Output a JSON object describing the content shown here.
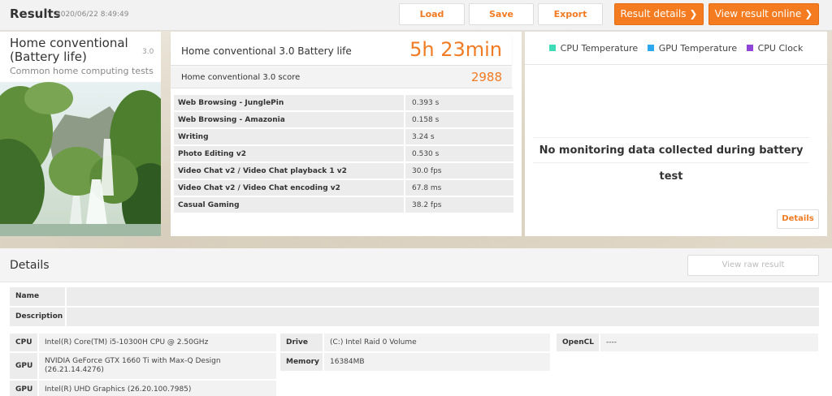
{
  "header": {
    "title": "Results",
    "date": "2020/06/22 8:49:49",
    "buttons": {
      "load": "Load",
      "save": "Save",
      "export": "Export",
      "result_details": "Result details",
      "view_online": "View result online"
    }
  },
  "test": {
    "name": "Home conventional (Battery life)",
    "version": "3.0",
    "description": "Common home computing tests"
  },
  "scores": {
    "main_label": "Home conventional 3.0 Battery life",
    "main_value": "5h 23min",
    "score_label": "Home conventional 3.0 score",
    "score_value": "2988",
    "subtests": [
      {
        "name": "Web Browsing - JunglePin",
        "value": "0.393 s"
      },
      {
        "name": "Web Browsing - Amazonia",
        "value": "0.158 s"
      },
      {
        "name": "Writing",
        "value": "3.24 s"
      },
      {
        "name": "Photo Editing v2",
        "value": "0.530 s"
      },
      {
        "name": "Video Chat v2 / Video Chat playback 1 v2",
        "value": "30.0 fps"
      },
      {
        "name": "Video Chat v2 / Video Chat encoding v2",
        "value": "67.8 ms"
      },
      {
        "name": "Casual Gaming",
        "value": "38.2 fps"
      }
    ]
  },
  "monitoring": {
    "legend": [
      {
        "label": "CPU Temperature",
        "color": "#3ddbb7"
      },
      {
        "label": "GPU Temperature",
        "color": "#2da8ef"
      },
      {
        "label": "CPU Clock",
        "color": "#8e44d6"
      }
    ],
    "message": "No monitoring data collected during battery test",
    "details_button": "Details"
  },
  "details": {
    "title": "Details",
    "view_raw": "View raw result",
    "name_label": "Name",
    "name_value": "",
    "description_label": "Description",
    "description_value": "",
    "hardware": {
      "cpu_label": "CPU",
      "cpu_value": "Intel(R) Core(TM) i5-10300H CPU @ 2.50GHz",
      "gpu1_label": "GPU",
      "gpu1_value": "NVIDIA GeForce GTX 1660 Ti with Max-Q Design (26.21.14.4276)",
      "gpu2_label": "GPU",
      "gpu2_value": "Intel(R) UHD Graphics (26.20.100.7985)",
      "drive_label": "Drive",
      "drive_value": "(C:) Intel Raid 0 Volume",
      "memory_label": "Memory",
      "memory_value": "16384MB",
      "opencl_label": "OpenCL",
      "opencl_value": "----"
    }
  }
}
